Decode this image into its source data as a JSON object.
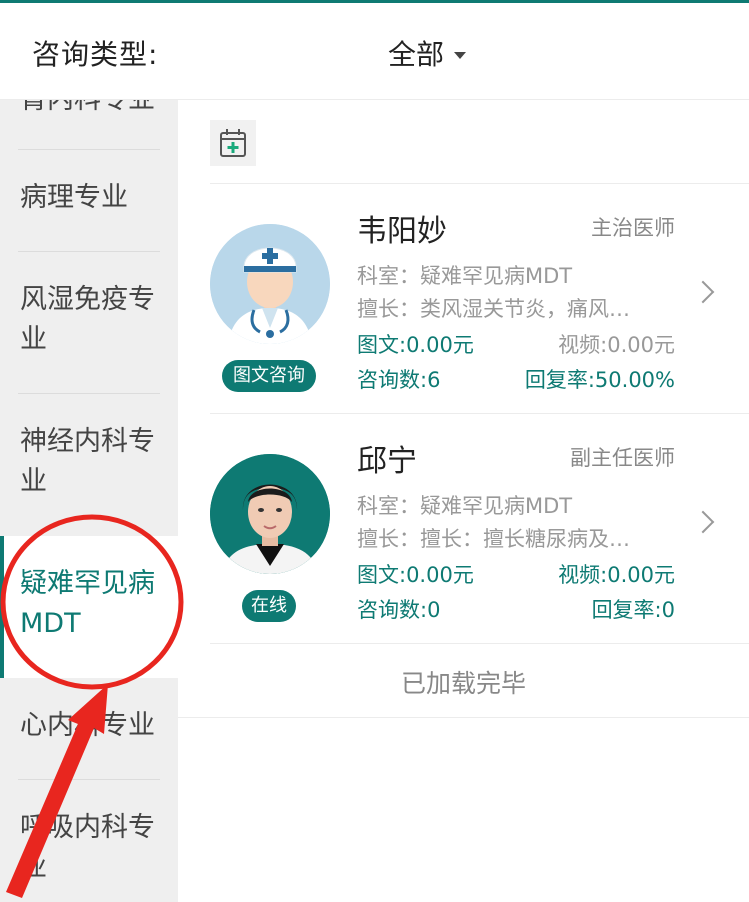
{
  "header": {
    "label": "咨询类型:",
    "filter": "全部"
  },
  "sidebar": {
    "items": [
      {
        "label": "肾内科专业"
      },
      {
        "label": "病理专业"
      },
      {
        "label": "风湿免疫专业"
      },
      {
        "label": "神经内科专业"
      },
      {
        "label": "疑难罕见病MDT",
        "active": true
      },
      {
        "label": "心内科专业"
      },
      {
        "label": "呼吸内科专业"
      }
    ]
  },
  "doctors": [
    {
      "name": "韦阳妙",
      "title": "主治医师",
      "dept": "科室：疑难罕见病MDT",
      "skill": "擅长：类风湿关节炎，痛风…",
      "text_price": "图文:0.00元",
      "video_price": "视频:0.00元",
      "consults": "咨询数:6",
      "reply_rate": "回复率:50.00%",
      "badge": "图文咨询"
    },
    {
      "name": "邱宁",
      "title": "副主任医师",
      "dept": "科室：疑难罕见病MDT",
      "skill": "擅长：擅长：擅长糖尿病及…",
      "text_price": "图文:0.00元",
      "video_price": "视频:0.00元",
      "consults": "咨询数:0",
      "reply_rate": "回复率:0",
      "badge": "在线"
    }
  ],
  "footer": {
    "loaded": "已加载完毕"
  },
  "colors": {
    "accent": "#0e7a73",
    "annotation": "#e8261f"
  },
  "icons": [
    "calendar-add-icon",
    "chevron-right-icon",
    "caret-down-icon"
  ]
}
